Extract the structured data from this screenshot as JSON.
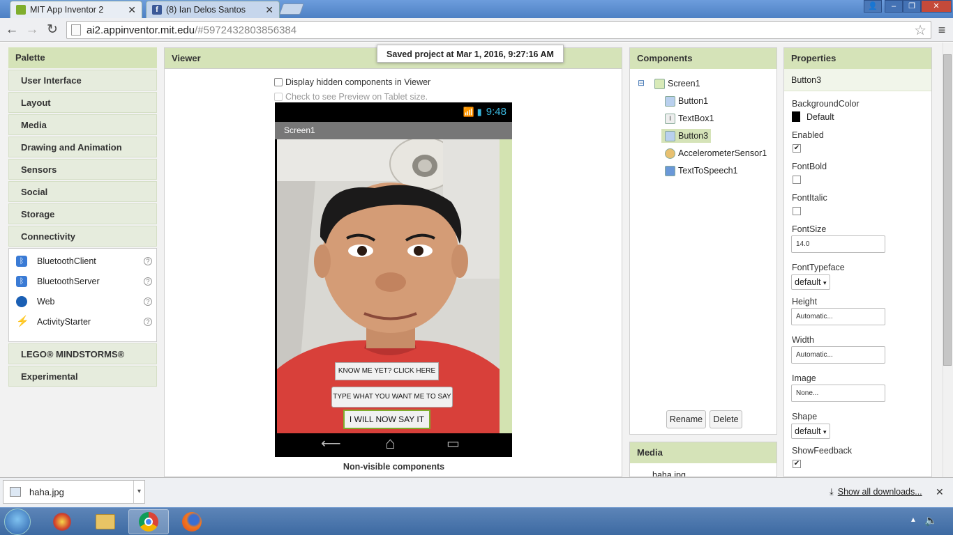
{
  "browser": {
    "tabs": [
      {
        "title": "MIT App Inventor 2",
        "active": true
      },
      {
        "title": "(8) Ian Delos Santos",
        "active": false
      }
    ],
    "url_host": "ai2.appinventor.mit.edu",
    "url_path": "/#5972432803856384"
  },
  "toast": "Saved project at Mar 1, 2016, 9:27:16 AM",
  "palette": {
    "title": "Palette",
    "categories_top": [
      "User Interface",
      "Layout",
      "Media",
      "Drawing and Animation",
      "Sensors",
      "Social",
      "Storage",
      "Connectivity"
    ],
    "connectivity_items": [
      "BluetoothClient",
      "BluetoothServer",
      "Web",
      "ActivityStarter"
    ],
    "help_glyph": "?",
    "categories_bottom": [
      "LEGO® MINDSTORMS®",
      "Experimental"
    ]
  },
  "viewer": {
    "title": "Viewer",
    "show_hidden_label": "Display hidden components in Viewer",
    "tablet_preview_label": "Check to see Preview on Tablet size.",
    "phone_time": "9:48",
    "screen_title": "Screen1",
    "button1_text": "KNOW ME YET? CLICK HERE",
    "textbox1_text": "TYPE WHAT YOU WANT ME TO SAY",
    "button3_text": "I WILL NOW SAY IT",
    "nav_back_glyph": "⟵",
    "nav_home_glyph": "⌂",
    "nav_recent_glyph": "▭",
    "nonvisible_label": "Non-visible components"
  },
  "components": {
    "title": "Components",
    "collapse_glyph": "⊟",
    "root": "Screen1",
    "children": [
      "Button1",
      "TextBox1",
      "Button3",
      "AccelerometerSensor1",
      "TextToSpeech1"
    ],
    "selected": "Button3",
    "rename_label": "Rename",
    "delete_label": "Delete"
  },
  "media": {
    "title": "Media",
    "files": [
      "haha.jpg"
    ]
  },
  "properties": {
    "title": "Properties",
    "component": "Button3",
    "background_color_label": "BackgroundColor",
    "background_color_value": "Default",
    "enabled_label": "Enabled",
    "enabled": true,
    "fontbold_label": "FontBold",
    "fontbold": false,
    "fontitalic_label": "FontItalic",
    "fontitalic": false,
    "fontsize_label": "FontSize",
    "fontsize_value": "14.0",
    "fonttypeface_label": "FontTypeface",
    "fonttypeface_value": "default",
    "height_label": "Height",
    "height_value": "Automatic...",
    "width_label": "Width",
    "width_value": "Automatic...",
    "image_label": "Image",
    "image_value": "None...",
    "shape_label": "Shape",
    "shape_value": "default",
    "showfeedback_label": "ShowFeedback",
    "showfeedback": true,
    "check_glyph": "✔",
    "dropdown_glyph": "▾"
  },
  "downloads": {
    "file": "haha.jpg",
    "show_all": "Show all downloads...",
    "close_glyph": "✕",
    "menu_glyph": "▾"
  },
  "colors": {
    "panel_header": "#d5e3b8",
    "selected": "#d5e3b8",
    "phone_accent": "#3ab8e0",
    "button_border_selected": "#7fae2e"
  }
}
